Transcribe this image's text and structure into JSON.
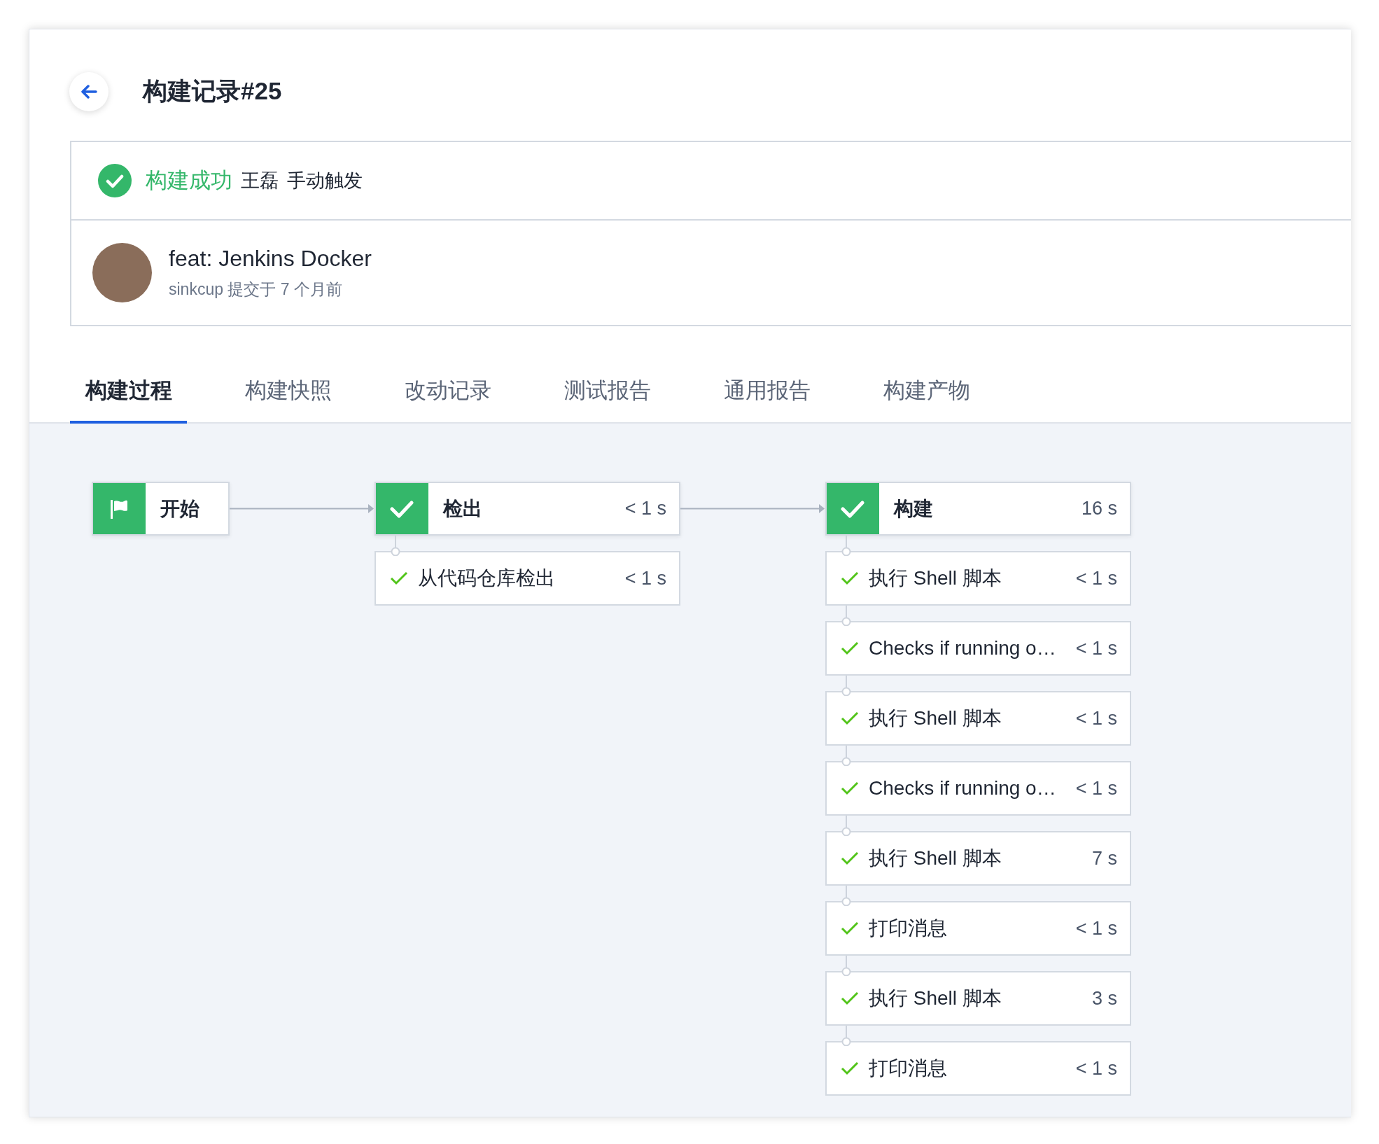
{
  "header": {
    "title": "构建记录#25"
  },
  "status": {
    "succeeded": true,
    "label": "构建成功",
    "user": "王磊",
    "trigger": "手动触发"
  },
  "commit": {
    "message": "feat: Jenkins Docker",
    "meta": "sinkcup 提交于 7 个月前"
  },
  "tabs": [
    {
      "label": "构建过程",
      "selected": true
    },
    {
      "label": "构建快照",
      "selected": false
    },
    {
      "label": "改动记录",
      "selected": false
    },
    {
      "label": "测试报告",
      "selected": false
    },
    {
      "label": "通用报告",
      "selected": false
    },
    {
      "label": "构建产物",
      "selected": false
    }
  ],
  "pipeline": [
    {
      "kind": "start",
      "name": "开始"
    },
    {
      "kind": "stage",
      "name": "检出",
      "succeeded": true,
      "duration": "< 1 s",
      "steps": [
        {
          "name": "从代码仓库检出",
          "succeeded": true,
          "duration": "< 1 s"
        }
      ]
    },
    {
      "kind": "stage",
      "name": "构建",
      "succeeded": true,
      "duration": "16 s",
      "steps": [
        {
          "name": "执行 Shell 脚本",
          "succeeded": true,
          "duration": "< 1 s"
        },
        {
          "name": "Checks if running o…",
          "succeeded": true,
          "duration": "< 1 s"
        },
        {
          "name": "执行 Shell 脚本",
          "succeeded": true,
          "duration": "< 1 s"
        },
        {
          "name": "Checks if running o…",
          "succeeded": true,
          "duration": "< 1 s"
        },
        {
          "name": "执行 Shell 脚本",
          "succeeded": true,
          "duration": "7 s"
        },
        {
          "name": "打印消息",
          "succeeded": true,
          "duration": "< 1 s"
        },
        {
          "name": "执行 Shell 脚本",
          "succeeded": true,
          "duration": "3 s"
        },
        {
          "name": "打印消息",
          "succeeded": true,
          "duration": "< 1 s"
        }
      ]
    }
  ]
}
